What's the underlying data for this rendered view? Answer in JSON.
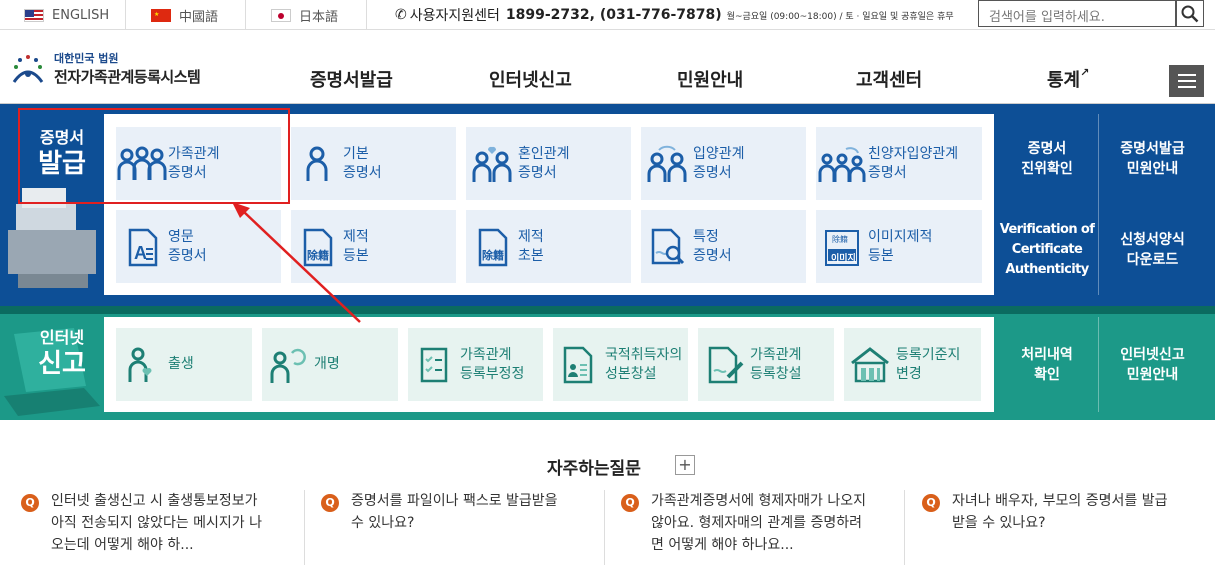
{
  "topbar": {
    "langs": [
      {
        "label": "ENGLISH"
      },
      {
        "label": "中國語"
      },
      {
        "label": "日本語"
      }
    ],
    "support": {
      "label": "사용자지원센터",
      "phone": "1899-2732, (031-776-7878)",
      "hours": "월~금요일 (09:00~18:00) / 토 · 일요일 및 공휴일은 휴무"
    },
    "search": {
      "placeholder": "검색어를 입력하세요."
    }
  },
  "header": {
    "logo": {
      "line1": "대한민국 법원",
      "line2": "전자가족관계등록시스템"
    },
    "nav": [
      "증명서발급",
      "인터넷신고",
      "민원안내",
      "고객센터",
      "통계"
    ]
  },
  "issue": {
    "label1": "증명서",
    "label2": "발급",
    "tiles": [
      {
        "l1": "가족관계",
        "l2": "증명서",
        "icon": "family-icon"
      },
      {
        "l1": "기본",
        "l2": "증명서",
        "icon": "person-icon"
      },
      {
        "l1": "혼인관계",
        "l2": "증명서",
        "icon": "marriage-icon"
      },
      {
        "l1": "입양관계",
        "l2": "증명서",
        "icon": "adoption-icon"
      },
      {
        "l1": "친양자입양관계",
        "l2": "증명서",
        "icon": "full-adoption-icon"
      },
      {
        "l1": "영문",
        "l2": "증명서",
        "icon": "english-doc-icon"
      },
      {
        "l1": "제적",
        "l2": "등본",
        "icon": "removed-register-icon"
      },
      {
        "l1": "제적",
        "l2": "초본",
        "icon": "removed-register-icon"
      },
      {
        "l1": "특정",
        "l2": "증명서",
        "icon": "search-doc-icon"
      },
      {
        "l1": "이미지제적",
        "l2": "등본",
        "icon": "image-register-icon"
      }
    ],
    "glyphs": {
      "removed": "除籍",
      "image": "이미지",
      "image_top": "除籍"
    },
    "right": [
      {
        "l1": "증명서",
        "l2": "진위확인"
      },
      {
        "l1": "증명서발급",
        "l2": "민원안내"
      },
      {
        "l1": "Verification of",
        "l2": "Certificate",
        "l3": "Authenticity"
      },
      {
        "l1": "신청서양식",
        "l2": "다운로드"
      }
    ]
  },
  "report": {
    "label1": "인터넷",
    "label2": "신고",
    "tiles": [
      {
        "l1": "출생",
        "icon": "birth-icon"
      },
      {
        "l1": "개명",
        "icon": "rename-icon"
      },
      {
        "l1": "가족관계",
        "l2": "등록부정정",
        "icon": "correction-icon"
      },
      {
        "l1": "국적취득자의",
        "l2": "성본창설",
        "icon": "nationality-icon"
      },
      {
        "l1": "가족관계",
        "l2": "등록창설",
        "icon": "creation-icon"
      },
      {
        "l1": "등록기준지",
        "l2": "변경",
        "icon": "house-icon"
      }
    ],
    "right": [
      {
        "l1": "처리내역",
        "l2": "확인"
      },
      {
        "l1": "인터넷신고",
        "l2": "민원안내"
      }
    ]
  },
  "faq": {
    "title": "자주하는질문",
    "badge": "Q",
    "items": [
      {
        "l1": "인터넷 출생신고 시 출생통보정보가",
        "l2": "아직 전송되지 않았다는 메시지가 나",
        "l3": "오는데 어떻게 해야 하..."
      },
      {
        "l1": "증명서를 파일이나 팩스로 발급받을",
        "l2": "수 있나요?"
      },
      {
        "l1": "가족관계증명서에 형제자매가 나오지",
        "l2": "않아요. 형제자매의 관계를 증명하려",
        "l3": "면 어떻게 해야 하나요..."
      },
      {
        "l1": "자녀나 배우자, 부모의 증명서를 발급",
        "l2": "받을 수 있나요?"
      }
    ]
  },
  "colors": {
    "navy": "#0d4f96",
    "teal": "#1c9988",
    "accent": "#e02020",
    "faq_badge": "#d95f1a"
  }
}
